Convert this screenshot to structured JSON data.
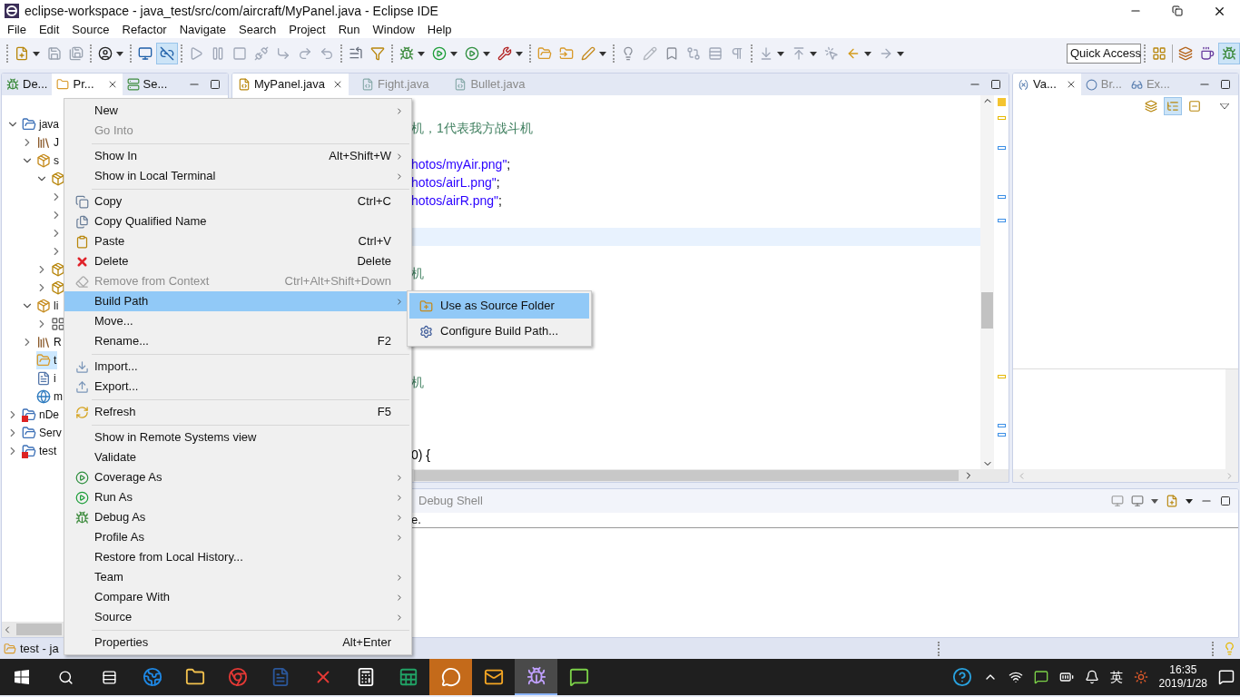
{
  "window": {
    "title": "eclipse-workspace - java_test/src/com/aircraft/MyPanel.java - Eclipse IDE"
  },
  "menu_bar": [
    "File",
    "Edit",
    "Source",
    "Refactor",
    "Navigate",
    "Search",
    "Project",
    "Run",
    "Window",
    "Help"
  ],
  "toolbar": {
    "groups": [
      [
        {
          "kind": "new",
          "dropdown": true,
          "selected": false
        },
        {
          "kind": "save",
          "dropdown": false,
          "selected": false
        },
        {
          "kind": "save-all",
          "dropdown": false,
          "selected": false
        }
      ],
      [
        {
          "kind": "user",
          "dropdown": true,
          "selected": false
        }
      ],
      [
        {
          "kind": "monitor",
          "dropdown": false,
          "selected": false
        },
        {
          "kind": "link",
          "dropdown": false,
          "selected": true
        }
      ],
      [
        {
          "kind": "resume",
          "dropdown": false,
          "selected": false
        },
        {
          "kind": "suspend",
          "dropdown": false,
          "selected": false
        },
        {
          "kind": "terminate",
          "dropdown": false,
          "selected": false
        },
        {
          "kind": "disconnect",
          "dropdown": false,
          "selected": false
        },
        {
          "kind": "step-into",
          "dropdown": false,
          "selected": false
        },
        {
          "kind": "step-over",
          "dropdown": false,
          "selected": false
        },
        {
          "kind": "step-return",
          "dropdown": false,
          "selected": false
        }
      ],
      [
        {
          "kind": "drop-frame",
          "dropdown": false,
          "selected": false
        },
        {
          "kind": "step-filter",
          "dropdown": false,
          "selected": false
        }
      ],
      [
        {
          "kind": "debug",
          "dropdown": true,
          "selected": false
        },
        {
          "kind": "run",
          "dropdown": true,
          "selected": false
        },
        {
          "kind": "coverage",
          "dropdown": true,
          "selected": false
        },
        {
          "kind": "tools",
          "dropdown": true,
          "selected": false
        }
      ],
      [
        {
          "kind": "open-type",
          "dropdown": false,
          "selected": false
        },
        {
          "kind": "open-task",
          "dropdown": false,
          "selected": false
        },
        {
          "kind": "pen",
          "dropdown": true,
          "selected": false
        }
      ],
      [
        {
          "kind": "lamp",
          "dropdown": false,
          "selected": false
        },
        {
          "kind": "pencil",
          "dropdown": false,
          "selected": false
        },
        {
          "kind": "mark",
          "dropdown": false,
          "selected": false
        },
        {
          "kind": "diff",
          "dropdown": false,
          "selected": false
        },
        {
          "kind": "block",
          "dropdown": false,
          "selected": false
        },
        {
          "kind": "pilcrow",
          "dropdown": false,
          "selected": false
        }
      ],
      [
        {
          "kind": "next",
          "dropdown": true,
          "selected": false
        },
        {
          "kind": "prev",
          "dropdown": true,
          "selected": false
        },
        {
          "kind": "last-edit",
          "dropdown": false,
          "selected": false
        },
        {
          "kind": "back",
          "dropdown": true,
          "selected": false
        },
        {
          "kind": "forward",
          "dropdown": true,
          "selected": false
        }
      ]
    ],
    "quick_access": "Quick Access",
    "perspectives": [
      {
        "kind": "open",
        "selected": false
      },
      {
        "kind": "java-ee",
        "selected": false
      },
      {
        "kind": "java",
        "selected": false
      },
      {
        "kind": "debug",
        "selected": true
      }
    ]
  },
  "left_panel": {
    "tabs": [
      {
        "label": "De...",
        "kind": "debug",
        "selected": false
      },
      {
        "label": "Pr...",
        "kind": "project",
        "selected": true
      },
      {
        "label": "Se...",
        "kind": "servers",
        "selected": false
      }
    ],
    "tree": [
      {
        "label": "java",
        "kind": "project",
        "expanded": true,
        "selected": false,
        "children": [
          {
            "label": "J",
            "kind": "library",
            "expanded": false,
            "selected": false
          },
          {
            "label": "s",
            "kind": "source",
            "expanded": true,
            "selected": false,
            "children": [
              {
                "kind": "package",
                "expanded": true,
                "selected": false,
                "children": [
                  {
                    "expanded": false,
                    "selected": false
                  },
                  {
                    "expanded": false,
                    "selected": false
                  },
                  {
                    "expanded": false,
                    "selected": false
                  },
                  {
                    "expanded": false,
                    "selected": false
                  }
                ]
              },
              {
                "kind": "package",
                "expanded": false,
                "selected": false
              },
              {
                "kind": "package",
                "expanded": false,
                "selected": false
              }
            ]
          },
          {
            "label": "li",
            "kind": "source",
            "expanded": true,
            "selected": false,
            "children": [
              {
                "kind": "grid",
                "expanded": false,
                "selected": false
              }
            ]
          },
          {
            "label": "R",
            "kind": "library",
            "expanded": false,
            "selected": false
          },
          {
            "label": "t",
            "kind": "folder",
            "selected": true
          },
          {
            "label": "i",
            "kind": "text",
            "selected": false
          },
          {
            "label": "m",
            "kind": "globe",
            "selected": false
          }
        ]
      },
      {
        "label": "nDe",
        "kind": "error-project",
        "expanded": false,
        "selected": false
      },
      {
        "label": "Serv",
        "kind": "folder-project",
        "expanded": false,
        "selected": false
      },
      {
        "label": "test",
        "kind": "error-project",
        "expanded": false,
        "selected": false
      }
    ]
  },
  "editor": {
    "tabs": [
      {
        "label": "MyPanel.java",
        "selected": true
      },
      {
        "label": "Fight.java",
        "selected": false
      },
      {
        "label": "Bullet.java",
        "selected": false
      }
    ],
    "lines": [
      {
        "current": false,
        "parts": [
          {
            "kind": "comment",
            "text": "机，1代表我方战斗机"
          }
        ]
      },
      {
        "current": false
      },
      {
        "current": false,
        "parts": [
          {
            "kind": "string",
            "text": "hotos/myAir.png\""
          },
          {
            "kind": "plain",
            "text": ";"
          }
        ]
      },
      {
        "current": false,
        "parts": [
          {
            "kind": "string",
            "text": "hotos/airL.png\""
          },
          {
            "kind": "plain",
            "text": ";"
          }
        ]
      },
      {
        "current": false,
        "parts": [
          {
            "kind": "string",
            "text": "hotos/airR.png\""
          },
          {
            "kind": "plain",
            "text": ";"
          }
        ]
      },
      {
        "current": false
      },
      {
        "current": true
      },
      {
        "current": false
      },
      {
        "current": false,
        "parts": [
          {
            "kind": "comment",
            "text": "机"
          }
        ]
      },
      {
        "current": false
      },
      {
        "current": false
      },
      {
        "current": false
      },
      {
        "current": false
      },
      {
        "current": false
      },
      {
        "current": false,
        "parts": [
          {
            "kind": "comment",
            "text": "机"
          }
        ]
      },
      {
        "current": false
      },
      {
        "current": false
      },
      {
        "current": false
      },
      {
        "current": false,
        "parts": [
          {
            "kind": "plain",
            "text": "0) {"
          }
        ]
      }
    ]
  },
  "right_panel": {
    "tabs": [
      {
        "label": "Va...",
        "kind": "variables",
        "selected": true
      },
      {
        "label": "Br...",
        "kind": "breakpoints",
        "selected": false
      },
      {
        "label": "Ex...",
        "kind": "expressions",
        "selected": false
      }
    ],
    "tools": [
      {
        "kind": "types",
        "selected": false
      },
      {
        "kind": "logical",
        "selected": true
      },
      {
        "kind": "collapse",
        "selected": false
      }
    ]
  },
  "bottom_panel": {
    "tab": "Debug Shell",
    "text": "e."
  },
  "context_menu": [
    {
      "kind": "plain",
      "label": "New",
      "submenu": true,
      "disabled": false,
      "selected": false
    },
    {
      "kind": "plain",
      "label": "Go Into",
      "submenu": false,
      "disabled": true,
      "selected": false
    },
    {
      "kind": "separator"
    },
    {
      "kind": "plain",
      "label": "Show In",
      "shortcut": "Alt+Shift+W",
      "submenu": true,
      "disabled": false,
      "selected": false
    },
    {
      "kind": "plain",
      "label": "Show in Local Terminal",
      "submenu": true,
      "disabled": false,
      "selected": false
    },
    {
      "kind": "separator"
    },
    {
      "kind": "copy",
      "label": "Copy",
      "shortcut": "Ctrl+C",
      "submenu": false,
      "disabled": false,
      "selected": false
    },
    {
      "kind": "copy-name",
      "label": "Copy Qualified Name",
      "submenu": false,
      "disabled": false,
      "selected": false
    },
    {
      "kind": "paste",
      "label": "Paste",
      "shortcut": "Ctrl+V",
      "submenu": false,
      "disabled": false,
      "selected": false
    },
    {
      "kind": "delete",
      "label": "Delete",
      "shortcut": "Delete",
      "submenu": false,
      "disabled": false,
      "selected": false
    },
    {
      "kind": "remove",
      "label": "Remove from Context",
      "shortcut": "Ctrl+Alt+Shift+Down",
      "submenu": false,
      "disabled": true,
      "selected": false
    },
    {
      "kind": "plain",
      "label": "Build Path",
      "submenu": true,
      "disabled": false,
      "selected": true
    },
    {
      "kind": "plain",
      "label": "Move...",
      "submenu": false,
      "disabled": false,
      "selected": false
    },
    {
      "kind": "plain",
      "label": "Rename...",
      "shortcut": "F2",
      "submenu": false,
      "disabled": false,
      "selected": false
    },
    {
      "kind": "separator"
    },
    {
      "kind": "import",
      "label": "Import...",
      "submenu": false,
      "disabled": false,
      "selected": false
    },
    {
      "kind": "export",
      "label": "Export...",
      "submenu": false,
      "disabled": false,
      "selected": false
    },
    {
      "kind": "separator"
    },
    {
      "kind": "refresh",
      "label": "Refresh",
      "shortcut": "F5",
      "submenu": false,
      "disabled": false,
      "selected": false
    },
    {
      "kind": "separator"
    },
    {
      "kind": "plain",
      "label": "Show in Remote Systems view",
      "submenu": false,
      "disabled": false,
      "selected": false
    },
    {
      "kind": "plain",
      "label": "Validate",
      "submenu": false,
      "disabled": false,
      "selected": false
    },
    {
      "kind": "coverage",
      "label": "Coverage As",
      "submenu": true,
      "disabled": false,
      "selected": false
    },
    {
      "kind": "run",
      "label": "Run As",
      "submenu": true,
      "disabled": false,
      "selected": false
    },
    {
      "kind": "debug",
      "label": "Debug As",
      "submenu": true,
      "disabled": false,
      "selected": false
    },
    {
      "kind": "plain",
      "label": "Profile As",
      "submenu": true,
      "disabled": false,
      "selected": false
    },
    {
      "kind": "plain",
      "label": "Restore from Local History...",
      "submenu": false,
      "disabled": false,
      "selected": false
    },
    {
      "kind": "plain",
      "label": "Team",
      "submenu": true,
      "disabled": false,
      "selected": false
    },
    {
      "kind": "plain",
      "label": "Compare With",
      "submenu": true,
      "disabled": false,
      "selected": false
    },
    {
      "kind": "plain",
      "label": "Source",
      "submenu": true,
      "disabled": false,
      "selected": false
    },
    {
      "kind": "separator"
    },
    {
      "kind": "plain",
      "label": "Properties",
      "shortcut": "Alt+Enter",
      "submenu": false,
      "disabled": false,
      "selected": false
    }
  ],
  "submenu": [
    {
      "kind": "source-folder",
      "label": "Use as Source Folder",
      "selected": true
    },
    {
      "kind": "configure",
      "label": "Configure Build Path...",
      "selected": false
    }
  ],
  "status_bar": {
    "text": "test - ja"
  },
  "taskbar": {
    "apps": [
      {
        "kind": "edge",
        "active": false,
        "flashing": false
      },
      {
        "kind": "explorer",
        "active": false,
        "flashing": false
      },
      {
        "kind": "chrome",
        "active": false,
        "flashing": false
      },
      {
        "kind": "word",
        "active": false,
        "flashing": false
      },
      {
        "kind": "xmind",
        "active": false,
        "flashing": false
      },
      {
        "kind": "calculator",
        "active": false,
        "flashing": false
      },
      {
        "kind": "excel",
        "active": false,
        "flashing": false
      },
      {
        "kind": "qq",
        "active": false,
        "flashing": true
      },
      {
        "kind": "mail",
        "active": false,
        "flashing": false
      },
      {
        "kind": "eclipse",
        "active": true,
        "flashing": false
      },
      {
        "kind": "wechat",
        "active": false,
        "flashing": false
      }
    ],
    "ime": "英",
    "time": "16:35",
    "date": "2019/1/28"
  }
}
